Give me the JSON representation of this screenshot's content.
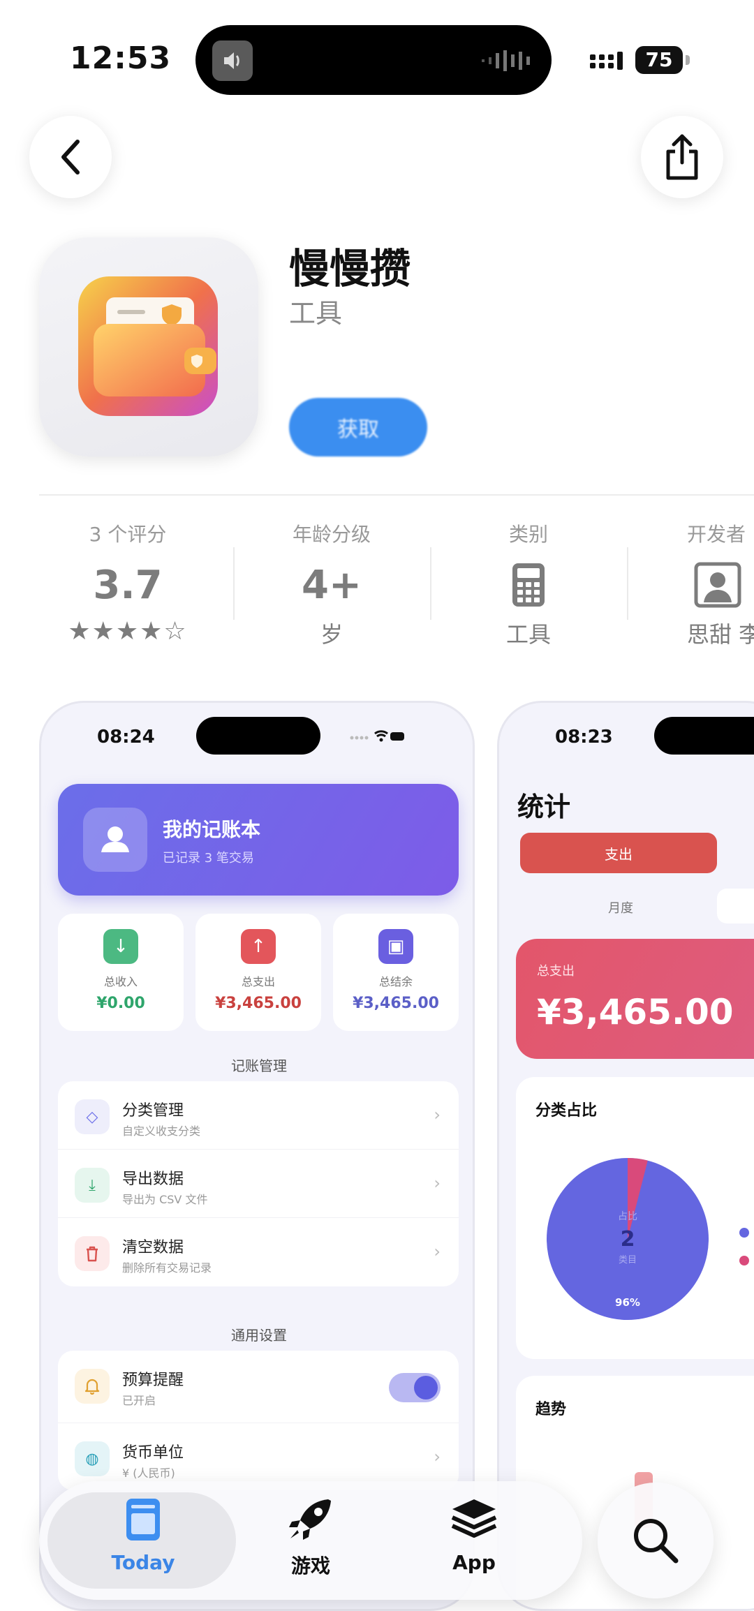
{
  "status_bar": {
    "time": "12:53",
    "battery": "75"
  },
  "app": {
    "name": "慢慢攒",
    "category": "工具",
    "get_label": "获取"
  },
  "info": {
    "ratings": {
      "label": "3 个评分",
      "value": "3.7",
      "stars": "★★★★☆"
    },
    "age": {
      "label": "年龄分级",
      "value": "4+",
      "sub": "岁"
    },
    "category": {
      "label": "类别",
      "sub": "工具",
      "icon": "calculator-icon"
    },
    "developer": {
      "label": "开发者",
      "sub": "思甜 李",
      "icon": "person-icon"
    }
  },
  "screenshot1": {
    "time": "08:24",
    "card": {
      "title": "我的记账本",
      "subtitle": "已记录 3 笔交易"
    },
    "stats": [
      {
        "label": "总收入",
        "value": "¥0.00",
        "color": "#2ea56b",
        "icon_bg": "#4cb982",
        "glyph": "↓"
      },
      {
        "label": "总支出",
        "value": "¥3,465.00",
        "color": "#c9413e",
        "icon_bg": "#e3565b",
        "glyph": "↑"
      },
      {
        "label": "总结余",
        "value": "¥3,465.00",
        "color": "#5b5fc7",
        "icon_bg": "#6a5fe0",
        "glyph": "▣"
      }
    ],
    "section1": "记账管理",
    "rows1": [
      {
        "title": "分类管理",
        "desc": "自定义收支分类",
        "icon_bg": "#eeeefb",
        "icon_color": "#6b6ee9",
        "glyph": "◇"
      },
      {
        "title": "导出数据",
        "desc": "导出为 CSV 文件",
        "icon_bg": "#e6f6ee",
        "icon_color": "#2ea56b",
        "glyph": "⤓"
      },
      {
        "title": "清空数据",
        "desc": "删除所有交易记录",
        "icon_bg": "#fdeaea",
        "icon_color": "#d9534f",
        "glyph": "🗑"
      }
    ],
    "section2": "通用设置",
    "rows2": [
      {
        "title": "预算提醒",
        "desc": "已开启",
        "icon_bg": "#fdf3e1",
        "icon_color": "#e0a030",
        "glyph": "🔔"
      },
      {
        "title": "货币单位",
        "desc": "¥ (人民币)",
        "icon_bg": "#e4f4f7",
        "icon_color": "#2aa0b8",
        "glyph": "◍"
      }
    ]
  },
  "screenshot2": {
    "time": "08:23",
    "title": "统计",
    "tab": "支出",
    "period": "月度",
    "total_label": "总支出",
    "total_value": "¥3,465.00",
    "pie_title": "分类占比",
    "pie_center_top": "占比",
    "pie_center_num": "2",
    "pie_center_bottom": "类目",
    "pie_percent": "96%",
    "pie_colors": [
      "#6466e0",
      "#d94a7b"
    ],
    "trend_title": "趋势"
  },
  "tabbar": {
    "today": "Today",
    "games": "游戏",
    "apps": "App"
  }
}
